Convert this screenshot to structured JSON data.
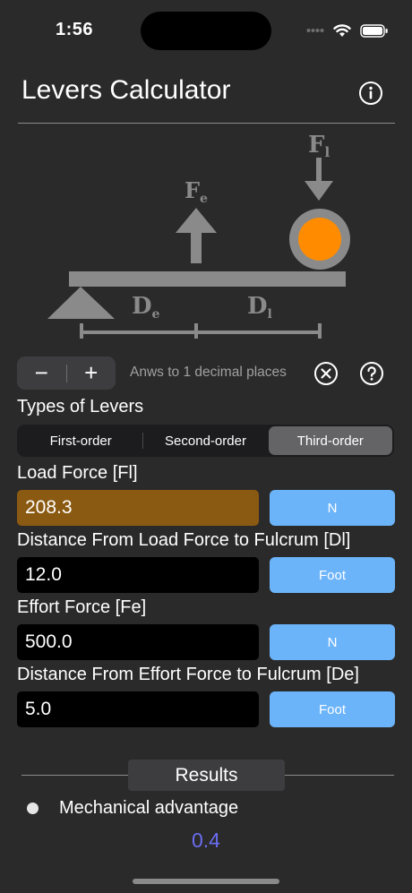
{
  "status_bar": {
    "time": "1:56",
    "icons": [
      "signal-icon",
      "wifi-icon",
      "battery-icon"
    ]
  },
  "header": {
    "title": "Levers Calculator",
    "info_icon": "info-icon"
  },
  "diagram": {
    "effort_label": "F",
    "effort_sub": "e",
    "load_label": "F",
    "load_sub": "l",
    "effort_dist_label": "D",
    "effort_dist_sub": "e",
    "load_dist_label": "D",
    "load_dist_sub": "l",
    "load_color": "#ff8c00",
    "shape_color": "#8a8a8a"
  },
  "precision": {
    "minus_label": "−",
    "plus_label": "+",
    "text": "Anws to 1 decimal places",
    "clear_icon": "clear-icon",
    "help_icon": "help-icon"
  },
  "lever_types": {
    "label": "Types of Levers",
    "options": [
      "First-order",
      "Second-order",
      "Third-order"
    ],
    "selected": "Third-order"
  },
  "fields": {
    "load_force": {
      "label": "Load Force [Fl]",
      "value": "208.3",
      "unit": "N"
    },
    "load_distance": {
      "label": "Distance From Load Force to Fulcrum [Dl]",
      "value": "12.0",
      "unit": "Foot"
    },
    "effort_force": {
      "label": "Effort Force [Fe]",
      "value": "500.0",
      "unit": "N"
    },
    "effort_distance": {
      "label": "Distance From Effort Force to Fulcrum [De]",
      "value": "5.0",
      "unit": "Foot"
    }
  },
  "results": {
    "header": "Results",
    "items": [
      {
        "label": "Mechanical advantage",
        "value": "0.4"
      }
    ]
  },
  "colors": {
    "background": "#2a2a2a",
    "highlight_field": "#8b5a12",
    "unit_button": "#6cb4fa",
    "result_value": "#6a6df0"
  }
}
